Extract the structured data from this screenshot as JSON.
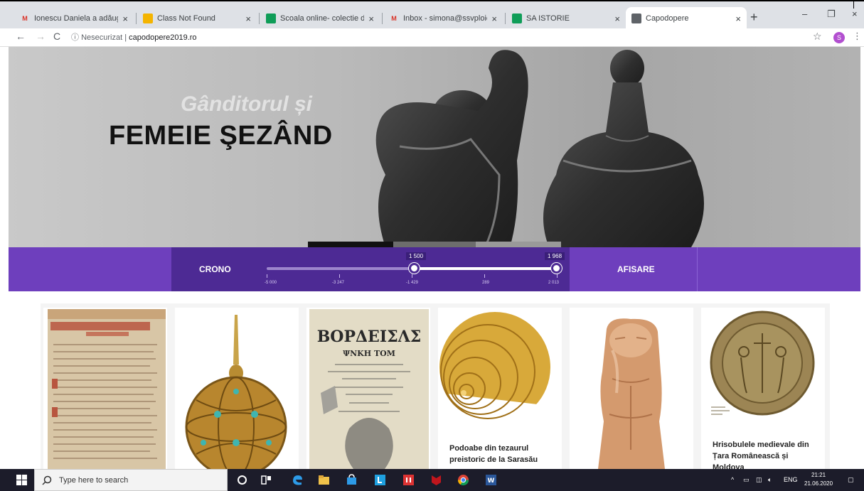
{
  "browser": {
    "tabs": [
      {
        "title": "Ionescu Daniela a adăugat un",
        "favicon": "gmail-icon",
        "color": "#d93025",
        "glyph": "M",
        "active": false
      },
      {
        "title": "Class Not Found",
        "favicon": "classroom-icon",
        "color": "#f4b400",
        "glyph": "▣",
        "active": false
      },
      {
        "title": "Scoala online- colectie de bu",
        "favicon": "classroom-icon",
        "color": "#0f9d58",
        "glyph": "▣",
        "active": false
      },
      {
        "title": "Inbox - simona@ssvploiesti.",
        "favicon": "gmail-icon",
        "color": "#d93025",
        "glyph": "M",
        "active": false
      },
      {
        "title": "SA ISTORIE",
        "favicon": "classroom-icon",
        "color": "#0f9d58",
        "glyph": "▣",
        "active": false
      },
      {
        "title": "Capodopere",
        "favicon": "page-icon",
        "color": "#5f6368",
        "glyph": "▣",
        "active": true
      }
    ],
    "address": {
      "security": "Nesecurizat",
      "host": "capodopere2019.ro"
    },
    "profile_initial": "S"
  },
  "hero": {
    "subtitle": "Gânditorul și",
    "title": "FEMEIE ŞEZÂND"
  },
  "filter": {
    "crono_label": "CRONO",
    "afisare_label": "AFISARE",
    "range_min_label": "1 500",
    "range_max_label": "1 968",
    "selected_range_fraction": [
      0.51,
      1.0
    ],
    "ticks": [
      "-5 000",
      "-3 247",
      "-1 429",
      "289",
      "2 013"
    ]
  },
  "cards": [
    {
      "name": "manuscript",
      "caption": ""
    },
    {
      "name": "golden-globe",
      "caption": ""
    },
    {
      "name": "printed-book",
      "caption": ""
    },
    {
      "name": "gold-spiral",
      "caption": "Podoabe din tezaurul preistoric de la Sarasău"
    },
    {
      "name": "idol-figurine",
      "caption": ""
    },
    {
      "name": "medieval-seal",
      "caption": "Hrisobulele medievale din Țara Românească și Moldova"
    }
  ],
  "taskbar": {
    "search_placeholder": "Type here to search",
    "language": "ENG",
    "time": "21:21",
    "date": "21.06.2020"
  }
}
